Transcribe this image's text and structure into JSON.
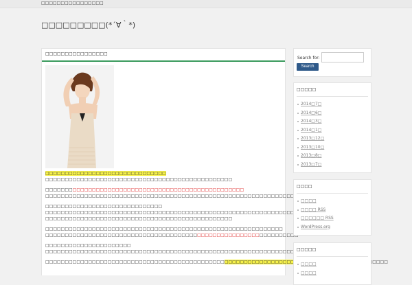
{
  "site": {
    "description": "□□□□□□□□□□□□□□□□",
    "title": "□□□□□□□□□(*´∀｀*)"
  },
  "post": {
    "title": "□□□□□□□□□□□□□□□□",
    "paragraphs": [
      {
        "lines": [
          [
            {
              "t": "□□□□□□□□□□□□□□□□□□□□□□□□□□□□□□□",
              "cls": "hl"
            }
          ],
          [
            {
              "t": "□□□□□□□□□□□□□□□□□□□□□□□□□□□□□□□□□□□□□□□□□□□□□□□□",
              "cls": ""
            }
          ]
        ]
      },
      {
        "lines": [
          [
            {
              "t": "□□□□□□□",
              "cls": ""
            },
            {
              "t": "□□□□□□□□□□□□□□□□□□□□□□□□□□□□□□□□□□□□□□□□□□□□",
              "cls": "red"
            }
          ],
          [
            {
              "t": "□□□□□□□□□□□□□□□□□□□□□□□□□□□□□□□□□□□□□□□□□□□□□□□□□□□□□□□□□□□□□□□□□□□□□□□□□□□",
              "cls": ""
            }
          ]
        ]
      },
      {
        "lines": [
          [
            {
              "t": "□□□□□□□□□□□□□□□□□□□□□□□□□□□□□□",
              "cls": ""
            }
          ],
          [
            {
              "t": "□□□□□□□□□□□□□□□□□□□□□□□□□□□□□□□□□□□□□□□□□□□□□□□□□□□□□□□□□□□□□□□□□□□□□□□□□□□□□□□□",
              "cls": ""
            }
          ],
          [
            {
              "t": "□□□□□□□□□□□□□□□□□□□□□□□□□□□□□□□□□□□□□□□□□□□□□□□□",
              "cls": ""
            }
          ]
        ]
      },
      {
        "lines": [
          [
            {
              "t": "□□□□□□□□□□□□□□□□□□□□□□□□□□□□□□□□□□□□□□□□□□□□□□□□□□□□□□□□□□□□□",
              "cls": ""
            }
          ],
          [
            {
              "t": "□□□□□□□□□□□□□□□□□□□□□□□□□□□□□□□□□□□□□□□",
              "cls": ""
            },
            {
              "t": "□□□□□□□□□□□□□□□□",
              "cls": "red"
            },
            {
              "t": "□□□□□□□□□□",
              "cls": ""
            }
          ]
        ]
      },
      {
        "lines": [
          [
            {
              "t": "□□□□□□□□□□□□□□□□□□□□□□",
              "cls": ""
            }
          ],
          [
            {
              "t": "□□□□□□□□□□□□□□□□□□□□□□□□□□□□□□□□□□□□□□□□□□□□□□□□□□□□□□□□□□□□□□□□□□□□□□□□□□□□□□□",
              "cls": ""
            }
          ]
        ]
      },
      {
        "lines": [
          [
            {
              "t": "□□□□□□□□□□□□□□□□□□□□□□□□□□□□□□□□□□□□□□□□□□□□□□",
              "cls": ""
            },
            {
              "t": "□□□□□□□□□□□□□□□□□□□□□□□□□□□□",
              "cls": "hl"
            },
            {
              "t": "□□□□□□□□□□□□□□",
              "cls": ""
            }
          ]
        ]
      }
    ]
  },
  "sidebar": {
    "search": {
      "label": "Search for:",
      "button": "Search",
      "value": ""
    },
    "archives": {
      "title": "□□□□□",
      "items": [
        "2014□7□",
        "2014□6□",
        "2014□3□",
        "2014□1□",
        "2013□12□",
        "2013□10□",
        "2013□8□",
        "2013□7□"
      ]
    },
    "meta": {
      "title": "□□□□",
      "items": [
        "□□□□",
        "□□□□ RSS",
        "□□□□□□ RSS",
        "WordPress.org"
      ]
    },
    "recent": {
      "title": "□□□□□",
      "items": [
        "□□□□",
        "□□□□"
      ]
    }
  },
  "colors": {
    "accent_rule": "#3a9a5c",
    "search_button": "#2f5a8a",
    "highlight": "#f7f24a",
    "red_text": "#dd2222"
  }
}
